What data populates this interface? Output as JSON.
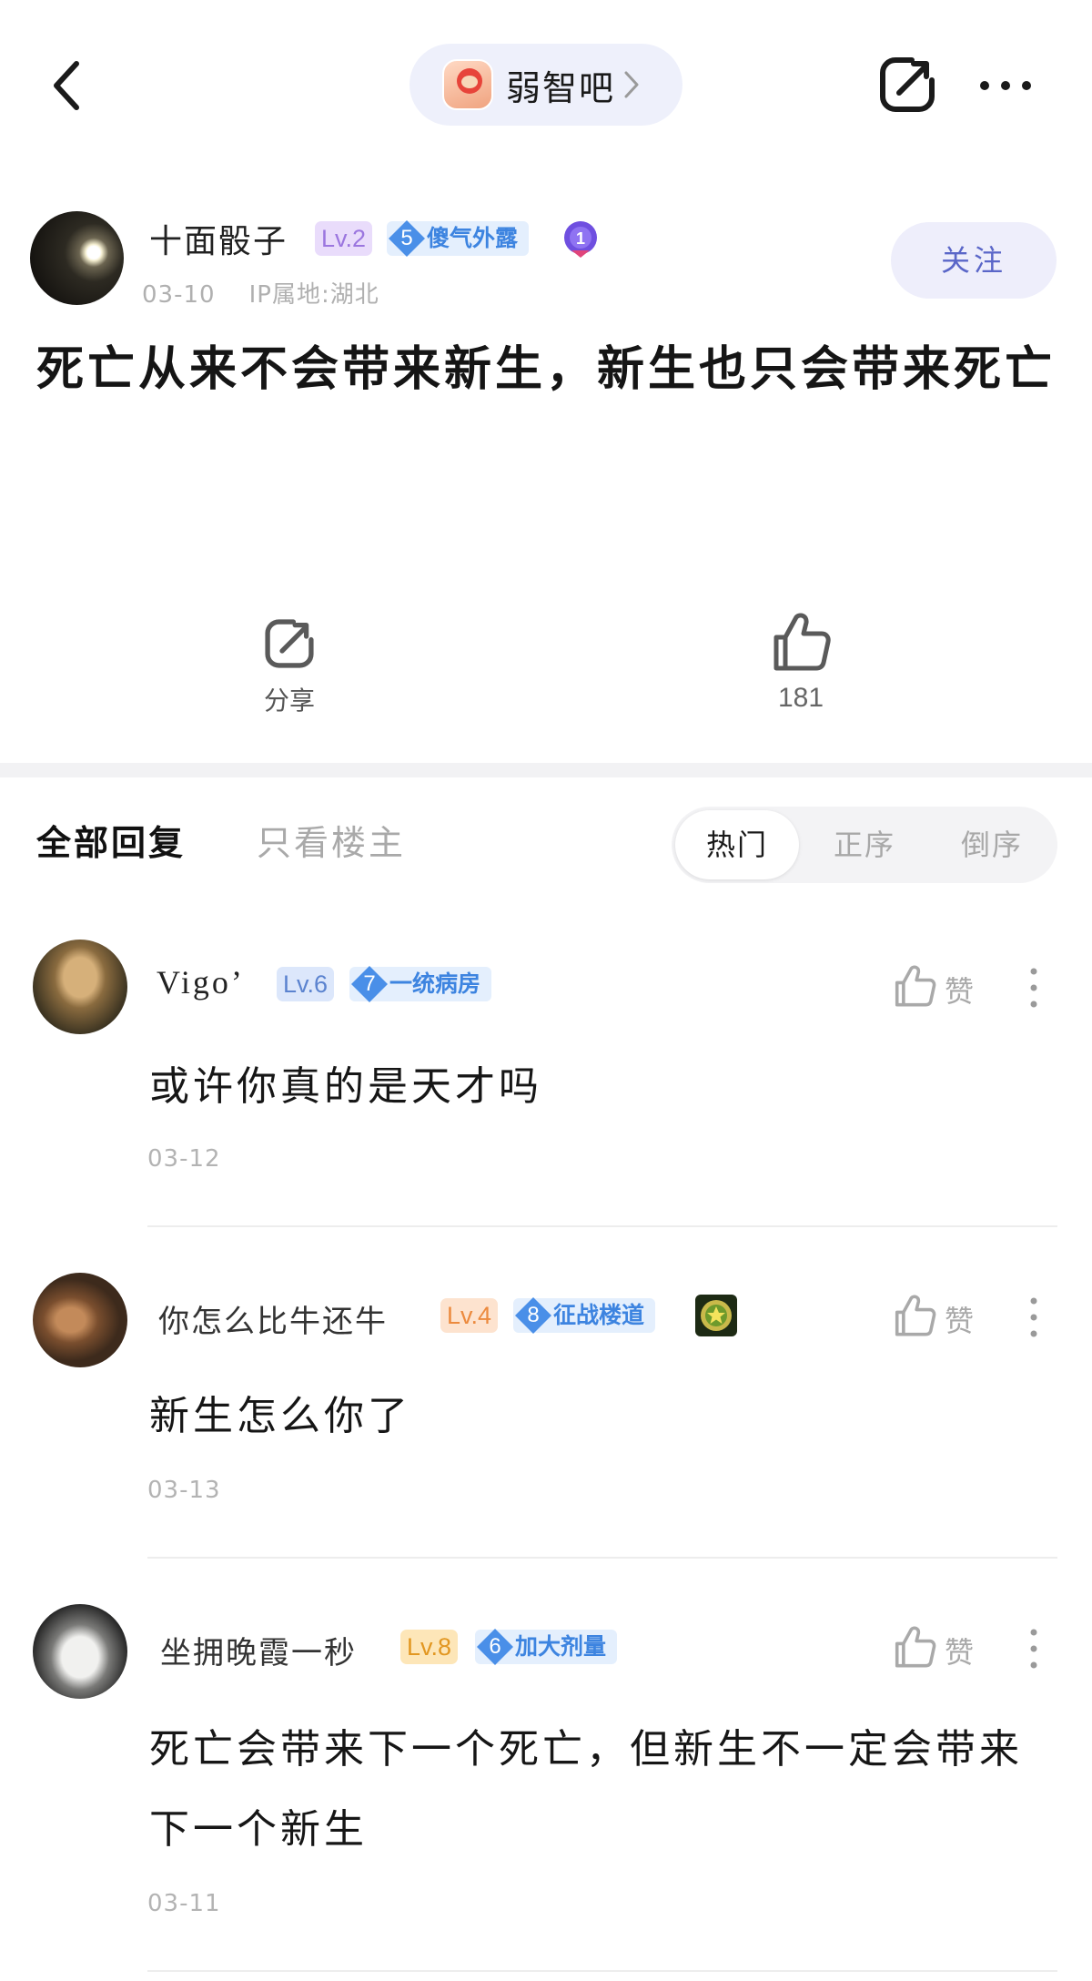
{
  "header": {
    "forum_name": "弱智吧"
  },
  "author": {
    "name": "十面骰子",
    "level": "Lv.2",
    "title_level": "5",
    "title": "傻气外露",
    "date": "03-10",
    "ip_location": "IP属地:湖北",
    "follow_label": "关注"
  },
  "post": {
    "title": "死亡从来不会带来新生，新生也只会带来死亡"
  },
  "actions": {
    "share_label": "分享",
    "like_count": "181"
  },
  "tabs": {
    "all_replies": "全部回复",
    "op_only": "只看楼主",
    "sort_hot": "热门",
    "sort_asc": "正序",
    "sort_desc": "倒序"
  },
  "comments": [
    {
      "name": "Vigo’",
      "level": "Lv.6",
      "title_level": "7",
      "title": "一统病房",
      "text": "或许你真的是天才吗",
      "date": "03-12",
      "like_label": "赞"
    },
    {
      "name": "你怎么比牛还牛",
      "level": "Lv.4",
      "title_level": "8",
      "title": "征战楼道",
      "text": "新生怎么你了",
      "date": "03-13",
      "like_label": "赞"
    },
    {
      "name": "坐拥晚霞一秒",
      "level": "Lv.8",
      "title_level": "6",
      "title": "加大剂量",
      "text": "死亡会带来下一个死亡，但新生不一定会带来下一个新生",
      "date": "03-11",
      "like_label": "赞"
    }
  ]
}
